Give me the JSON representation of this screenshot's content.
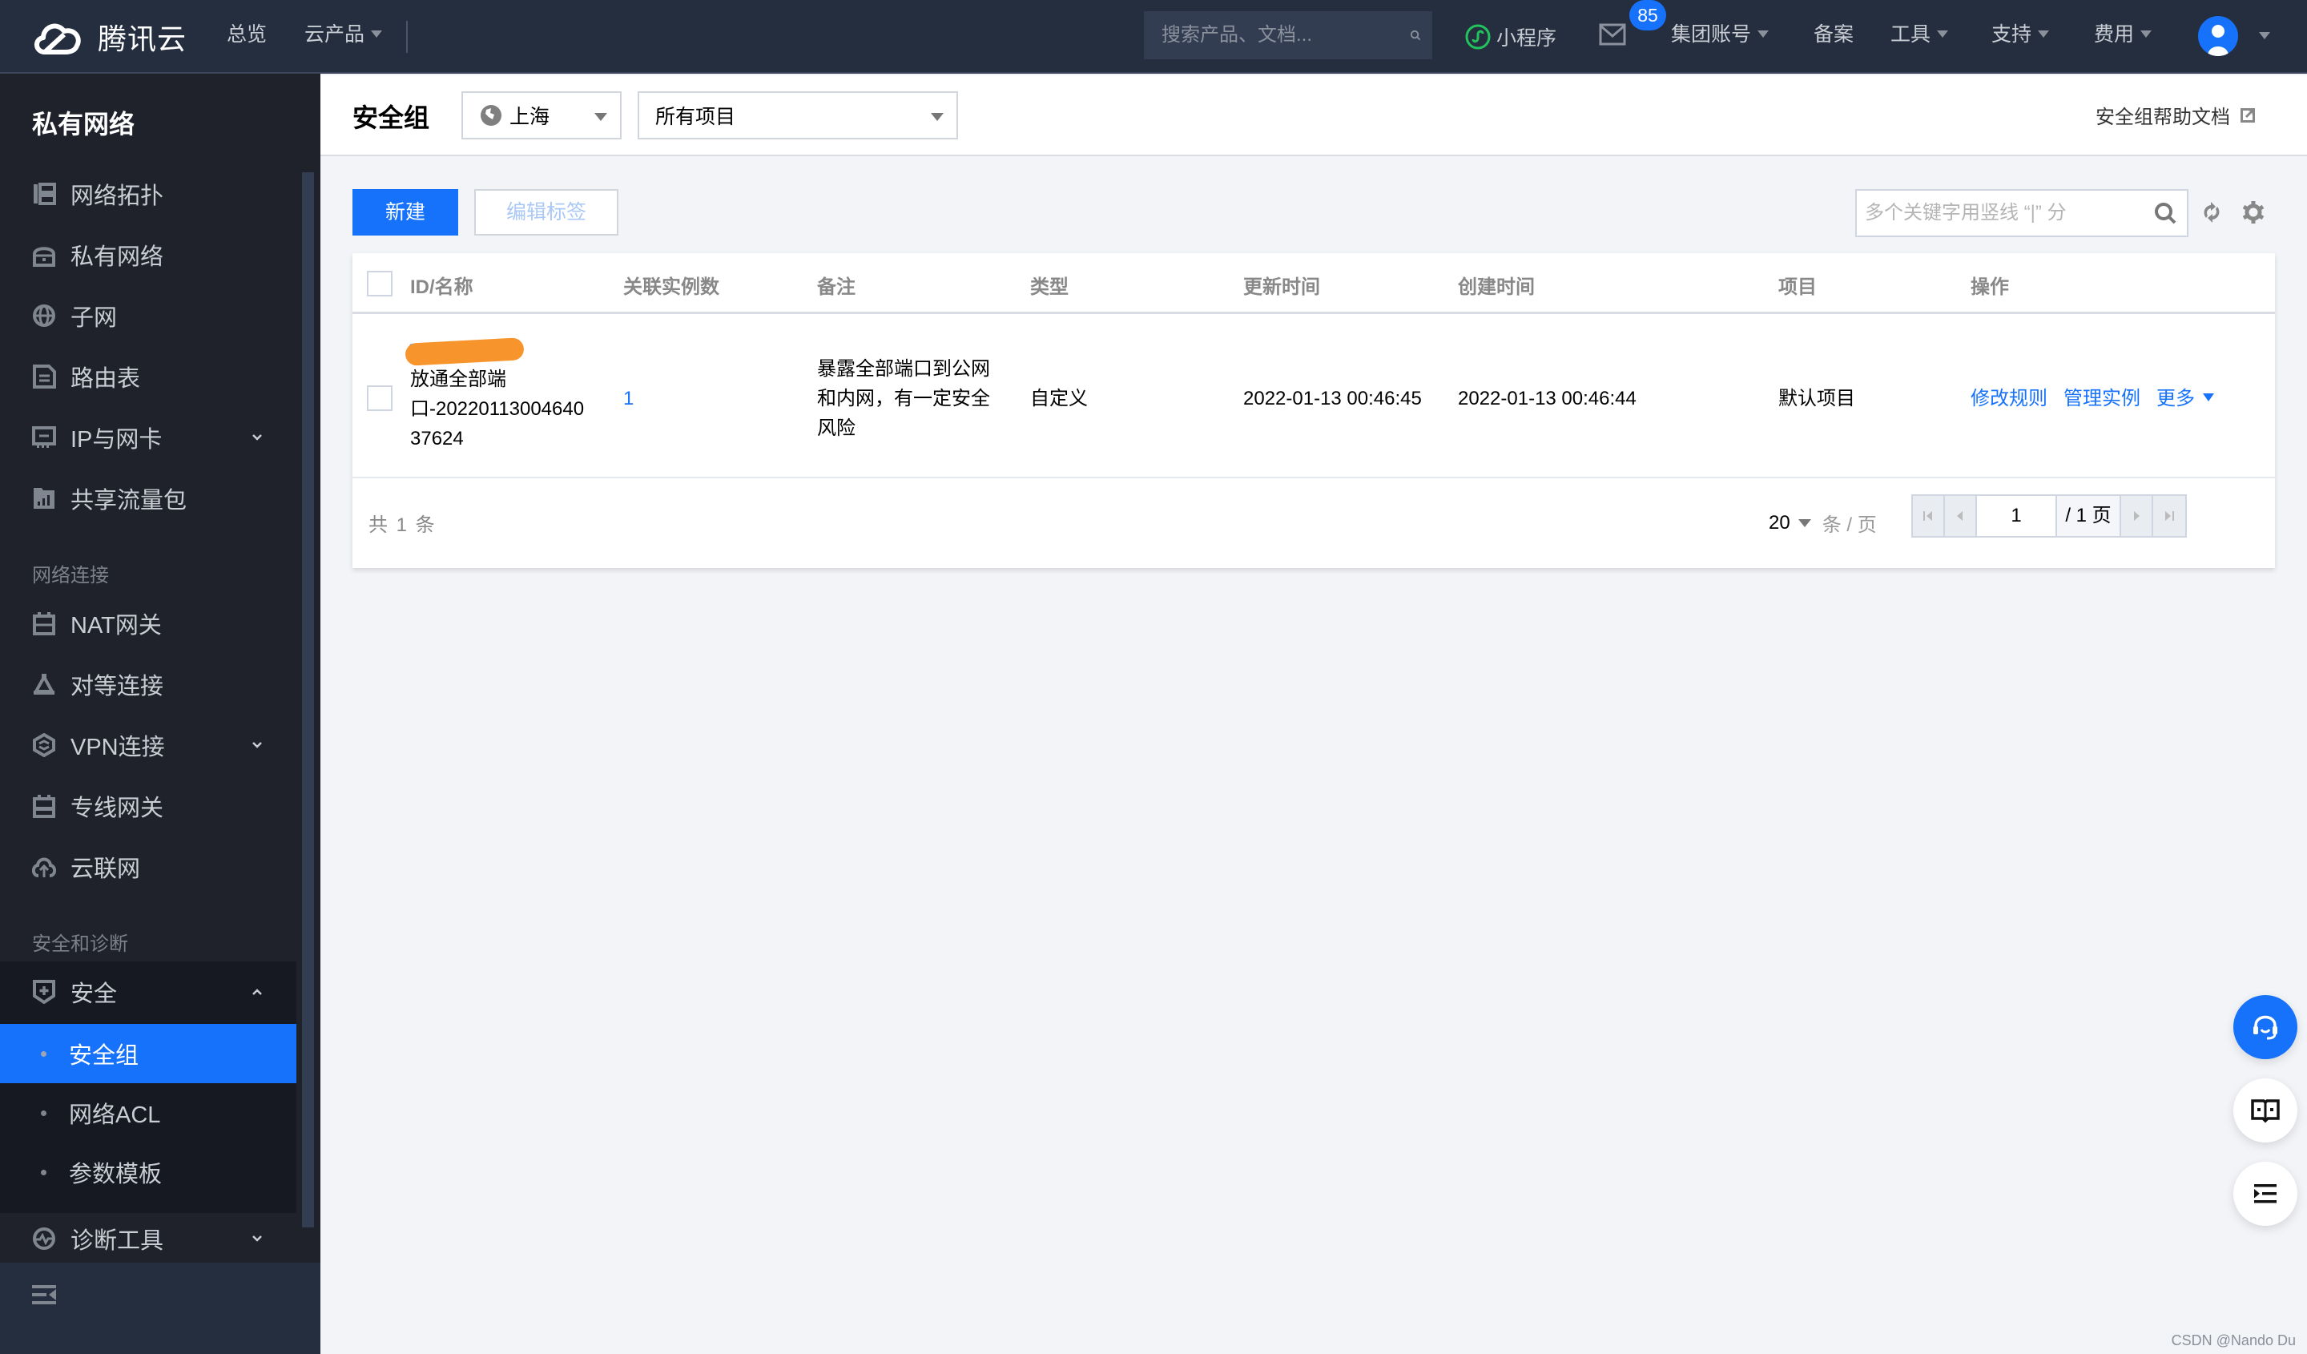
{
  "topnav": {
    "brand": "腾讯云",
    "links": [
      {
        "label": "总览",
        "has_caret": false
      },
      {
        "label": "云产品",
        "has_caret": true
      }
    ],
    "search_placeholder": "搜索产品、文档...",
    "mini_program": "小程序",
    "mail_badge": "85",
    "right_links": [
      {
        "label": "集团账号",
        "has_caret": true
      },
      {
        "label": "备案",
        "has_caret": false
      },
      {
        "label": "工具",
        "has_caret": true
      },
      {
        "label": "支持",
        "has_caret": true
      },
      {
        "label": "费用",
        "has_caret": true
      }
    ]
  },
  "sidebar": {
    "title": "私有网络",
    "items": [
      {
        "label": "网络拓扑",
        "icon": "topology-icon"
      },
      {
        "label": "私有网络",
        "icon": "vpc-icon"
      },
      {
        "label": "子网",
        "icon": "globe-icon"
      },
      {
        "label": "路由表",
        "icon": "document-icon"
      },
      {
        "label": "IP与网卡",
        "icon": "nic-icon",
        "expandable": true
      },
      {
        "label": "共享流量包",
        "icon": "traffic-package-icon"
      }
    ],
    "section_network": "网络连接",
    "network_items": [
      {
        "label": "NAT网关",
        "icon": "nat-gateway-icon"
      },
      {
        "label": "对等连接",
        "icon": "peering-icon"
      },
      {
        "label": "VPN连接",
        "icon": "vpn-icon",
        "expandable": true
      },
      {
        "label": "专线网关",
        "icon": "dc-gateway-icon"
      },
      {
        "label": "云联网",
        "icon": "ccn-icon"
      }
    ],
    "section_security": "安全和诊断",
    "security_group": {
      "label": "安全",
      "expanded": true,
      "children": [
        {
          "label": "安全组",
          "active": true
        },
        {
          "label": "网络ACL",
          "active": false
        },
        {
          "label": "参数模板",
          "active": false
        }
      ]
    },
    "diagnose": {
      "label": "诊断工具"
    }
  },
  "header": {
    "title": "安全组",
    "region": "上海",
    "project": "所有项目",
    "help_link": "安全组帮助文档"
  },
  "toolbar": {
    "new_label": "新建",
    "edit_tags_label": "编辑标签",
    "search_placeholder": "多个关键字用竖线 “|” 分"
  },
  "table": {
    "columns": [
      "ID/名称",
      "关联实例数",
      "备注",
      "类型",
      "更新时间",
      "创建时间",
      "项目",
      "操作"
    ],
    "rows": [
      {
        "id_redacted": "sg-••••••",
        "name_lines": [
          "放通全部端",
          "口-20220113004640",
          "37624"
        ],
        "instances": "1",
        "remark_lines": [
          "暴露全部端口到公网",
          "和内网，有一定安全",
          "风险"
        ],
        "type": "自定义",
        "updated": "2022-01-13 00:46:45",
        "created": "2022-01-13 00:46:44",
        "project": "默认项目",
        "actions": [
          "修改规则",
          "管理实例",
          "更多"
        ]
      }
    ],
    "total": "共 1 条",
    "page_size": "20",
    "page_size_unit": "条 / 页",
    "current_page": "1",
    "total_pages": "/ 1 页"
  },
  "watermark": "CSDN @Nando Du",
  "colors": {
    "accent": "#1672fb",
    "topnav_bg": "#252e3e",
    "sidebar_bg": "#1f222b",
    "page_bg": "#f2f4f8"
  }
}
